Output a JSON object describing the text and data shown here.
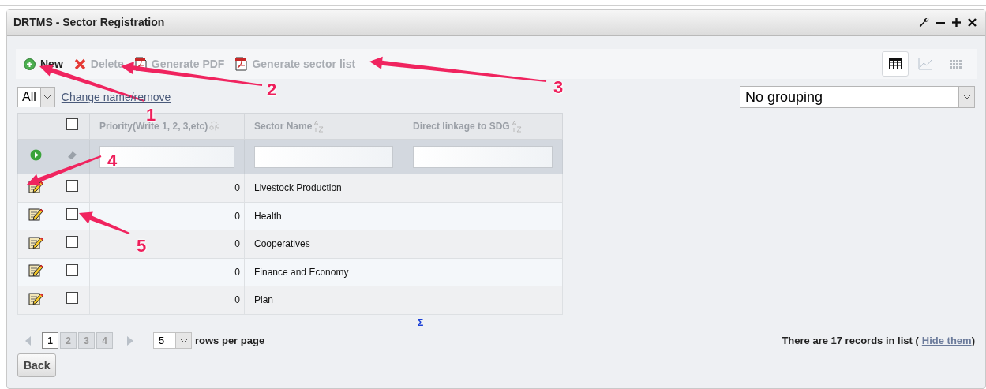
{
  "window": {
    "title": "DRTMS - Sector Registration"
  },
  "toolbar": [
    {
      "label": "New",
      "kind": "add",
      "disabled": false
    },
    {
      "label": "Delete",
      "kind": "delete",
      "disabled": true
    },
    {
      "label": "Generate PDF",
      "kind": "pdf",
      "disabled": true
    },
    {
      "label": "Generate sector list",
      "kind": "pdf",
      "disabled": true
    }
  ],
  "views": [
    {
      "kind": "table",
      "selected": true
    },
    {
      "kind": "chart",
      "selected": false
    },
    {
      "kind": "tiles",
      "selected": false
    }
  ],
  "filter": {
    "value": "All",
    "link": "Change name/remove"
  },
  "grouping": {
    "value": "No grouping"
  },
  "table": {
    "columns": [
      {
        "label": "Priority(Write 1, 2, 3,etc)"
      },
      {
        "label": "Sector Name"
      },
      {
        "label": "Direct linkage to SDG"
      }
    ],
    "select_all_checked": false,
    "rows": [
      {
        "priority": "0",
        "sector": "Livestock Production",
        "checked": false
      },
      {
        "priority": "0",
        "sector": "Health",
        "checked": false
      },
      {
        "priority": "0",
        "sector": "Cooperatives",
        "checked": false
      },
      {
        "priority": "0",
        "sector": "Finance and Economy",
        "checked": false
      },
      {
        "priority": "0",
        "sector": "Plan",
        "checked": false
      }
    ],
    "sum_symbol": "Σ"
  },
  "pagination": {
    "pages": [
      {
        "label": "1",
        "selected": true
      },
      {
        "label": "2",
        "selected": false
      },
      {
        "label": "3",
        "selected": false
      },
      {
        "label": "4",
        "selected": false
      }
    ],
    "rows_per_page": "5",
    "rows_per_page_label": "rows per page"
  },
  "records": {
    "text": "There are 17 records in list (",
    "link": "Hide them",
    "close": ")"
  },
  "back_button": "Back",
  "annotations": [
    {
      "label": "1"
    },
    {
      "label": "2"
    },
    {
      "label": "3"
    },
    {
      "label": "4"
    },
    {
      "label": "5"
    }
  ]
}
